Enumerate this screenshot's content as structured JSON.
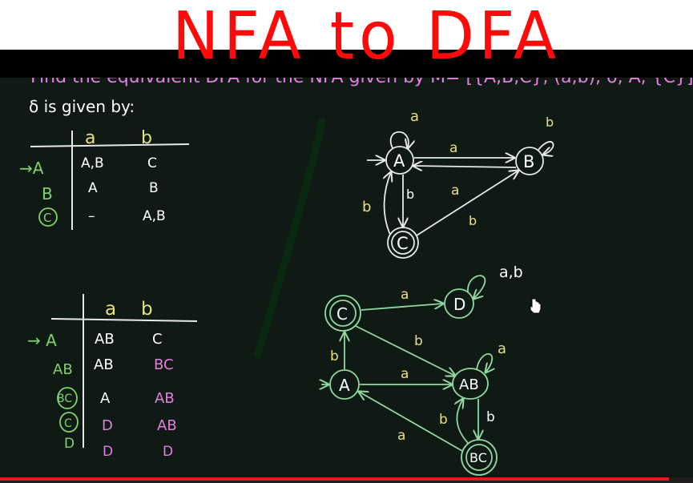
{
  "overlay": {
    "title": "NFA to DFA"
  },
  "board": {
    "problem_line": "Find the equivalent DFA for the NFA given by M= [{A,B,C}, (a,b), δ, A, {C}] where",
    "delta_line": "δ is given by:",
    "nfa_table": {
      "columns": [
        "a",
        "b"
      ],
      "rows": [
        {
          "state": "→A",
          "a": "A,B",
          "b": "C"
        },
        {
          "state": "B",
          "a": "A",
          "b": "B"
        },
        {
          "state": "C",
          "a": "–",
          "b": "A,B"
        }
      ]
    },
    "dfa_table": {
      "columns": [
        "a",
        "b"
      ],
      "rows": [
        {
          "state": "→ A",
          "a": "AB",
          "b": "C"
        },
        {
          "state": "AB",
          "a": "AB",
          "b": "BC"
        },
        {
          "state": "BC",
          "a": "A",
          "b": "AB"
        },
        {
          "state": "C",
          "a": "D",
          "b": "AB"
        },
        {
          "state": "D",
          "a": "D",
          "b": "D"
        }
      ]
    },
    "nfa_diagram": {
      "states": [
        "A",
        "B",
        "C"
      ],
      "edge_labels": [
        "a",
        "b",
        "a",
        "a",
        "b",
        "b",
        "b"
      ]
    },
    "dfa_diagram": {
      "states": [
        "C",
        "D",
        "A",
        "AB",
        "BC"
      ],
      "edge_labels": [
        "a",
        "a,b",
        "b",
        "b",
        "a",
        "a",
        "b",
        "b",
        "a"
      ]
    }
  },
  "colors": {
    "accent_green": "#7fd36a",
    "label_yellow": "#e8e07a",
    "pink": "#e27fe0",
    "white_ink": "#e8e8e8",
    "red_title": "#ff0a0a",
    "progress_red": "#e01c1c"
  },
  "player": {
    "progress": 0.965
  }
}
